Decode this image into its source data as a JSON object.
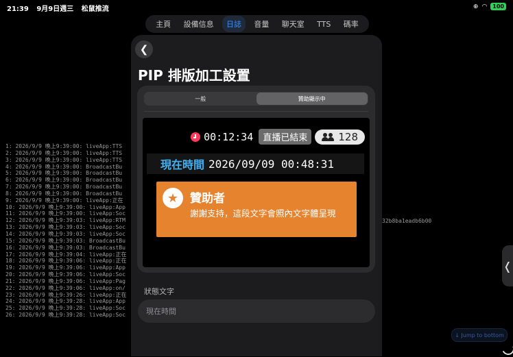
{
  "status_bar": {
    "time": "21:39",
    "date": "9月9日週三",
    "app_name": "松鼠推流",
    "battery": "100"
  },
  "tabs": [
    {
      "label": "主頁"
    },
    {
      "label": "設備信息"
    },
    {
      "label": "日誌"
    },
    {
      "label": "音量"
    },
    {
      "label": "聊天室"
    },
    {
      "label": "TTS"
    },
    {
      "label": "碼率"
    }
  ],
  "active_tab": "日誌",
  "log_lines": [
    "1: 2026/9/9 晚上9:39:00: liveApp:TTS",
    "2: 2026/9/9 晚上9:39:00: liveApp:TTS",
    "3: 2026/9/9 晚上9:39:00: liveApp:TTS",
    "4: 2026/9/9 晚上9:39:00: BroadcastBu",
    "5: 2026/9/9 晚上9:39:00: BroadcastBu",
    "6: 2026/9/9 晚上9:39:00: BroadcastBu",
    "7: 2026/9/9 晚上9:39:00: BroadcastBu",
    "8: 2026/9/9 晚上9:39:00: BroadcastBu",
    "9: 2026/9/9 晚上9:39:00: liveApp:正在",
    "10: 2026/9/9 晚上9:39:00: liveApp:App",
    "11: 2026/9/9 晚上9:39:00: liveApp:Soc",
    "12: 2026/9/9 晚上9:39:03: liveApp:RTM",
    "13: 2026/9/9 晚上9:39:03: liveApp:Soc",
    "14: 2026/9/9 晚上9:39:03: liveApp:Soc",
    "15: 2026/9/9 晚上9:39:03: BroadcastBu",
    "16: 2026/9/9 晚上9:39:03: BroadcastBu",
    "17: 2026/9/9 晚上9:39:04: liveApp:正在",
    "18: 2026/9/9 晚上9:39:06: liveApp:正在",
    "19: 2026/9/9 晚上9:39:06: liveApp:App",
    "20: 2026/9/9 晚上9:39:06: liveApp:Soc",
    "21: 2026/9/9 晚上9:39:06: liveApp:Pag",
    "22: 2026/9/9 晚上9:39:06: liveApp:on/",
    "23: 2026/9/9 晚上9:39:26: liveApp:正在",
    "24: 2026/9/9 晚上9:39:28: liveApp:App",
    "25: 2026/9/9 晚上9:39:28: liveApp:Soc",
    "26: 2026/9/9 晚上9:39:28: liveApp:Soc"
  ],
  "log_hash_fragment": "32b8ba1eadb6b00",
  "jump_to_bottom": "↓ Jump to bottom",
  "sheet": {
    "title": "PIP 排版加工設置",
    "segments": [
      {
        "label": "一般",
        "selected": false
      },
      {
        "label": "贊助顯示中",
        "selected": true
      }
    ],
    "preview": {
      "timer": "00:12:34",
      "ended_badge": "直播已結束",
      "viewer_count": "128",
      "time_label": "現在時間",
      "time_value": "2026/09/09 00:48:31",
      "sponsor": {
        "title": "贊助者",
        "body": "謝謝支持，這段文字會照內文字體呈現",
        "color": "#e6832e"
      }
    },
    "status_text": {
      "label": "狀態文字",
      "placeholder": "現在時間"
    }
  },
  "colors": {
    "accent_blue": "#3e8ef7",
    "time_label": "#3fb2f5",
    "timer_icon": "#ff3b5c",
    "battery": "#2fd158"
  }
}
